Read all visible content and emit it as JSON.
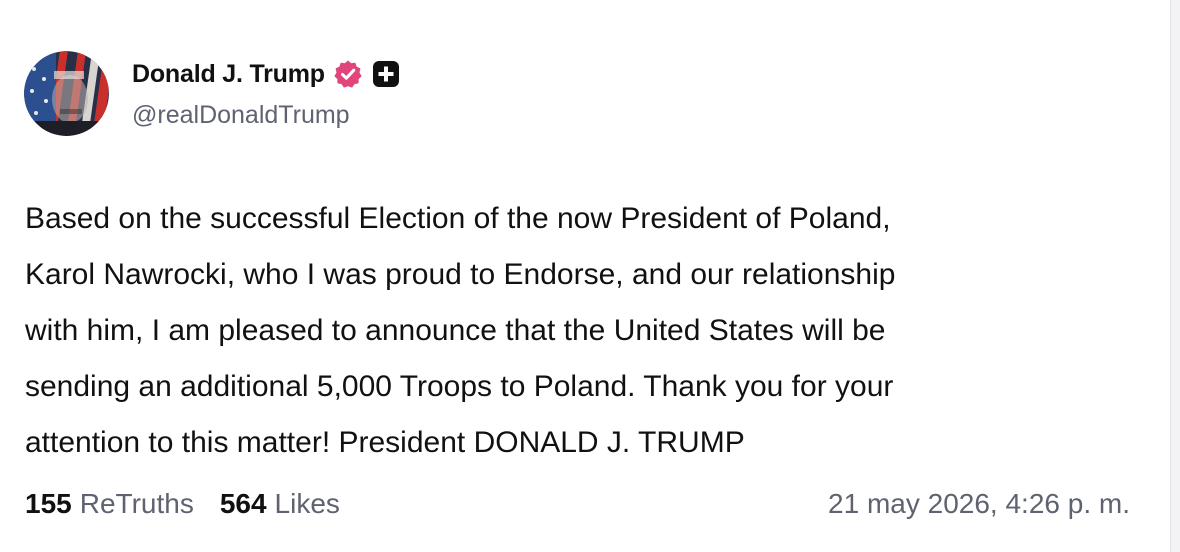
{
  "author": {
    "display_name": "Donald J. Trump",
    "handle": "@realDonaldTrump",
    "verified_icon": "verified-badge-icon",
    "extra_icon": "plus-square-icon",
    "badge_color": "#e0457b"
  },
  "post": {
    "text": "Based on the successful Election of the now President of Poland,\nKarol Nawrocki, who I was proud to Endorse, and our relationship\nwith him, I am pleased to announce that the United States will be\nsending an additional 5,000 Troops to Poland. Thank you for your\nattention to this matter! President DONALD J. TRUMP"
  },
  "stats": {
    "retruths_count": "155",
    "retruths_label": "ReTruths",
    "likes_count": "564",
    "likes_label": "Likes"
  },
  "timestamp": "21 may 2026, 4:26 p. m."
}
